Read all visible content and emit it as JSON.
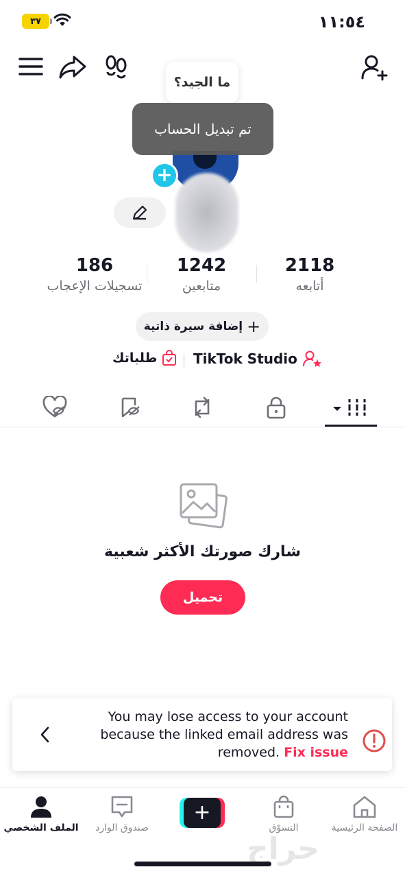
{
  "status_bar": {
    "time": "١١:٥٤",
    "battery": "٣٧"
  },
  "tooltip_question": "ما الجيد؟",
  "toast_message": "تم تبديل الحساب",
  "stats": {
    "likes": {
      "value": "186",
      "label": "تسجيلات الإعجاب"
    },
    "followers": {
      "value": "1242",
      "label": "متابعين"
    },
    "following": {
      "value": "2118",
      "label": "أتابعه"
    }
  },
  "bio_button": {
    "plus": "+",
    "label": "إضافة سيرة ذاتية"
  },
  "links": {
    "studio": "TikTok Studio",
    "orders": "طلباتك"
  },
  "empty_state": {
    "title": "شارك صورتك الأكثر شعبية",
    "button": "تحميل"
  },
  "banner": {
    "message": "You may lose access to your account because the linked email address was removed.",
    "fix_label": "Fix issue"
  },
  "bottom_nav": {
    "profile": "الملف الشخصي",
    "inbox": "صندوق الوارد",
    "create": "+",
    "shop": "التسوّق",
    "home": "الصفحة الرئيسية"
  },
  "colors": {
    "accent": "#fe2c55",
    "cyan": "#25f4ee",
    "text": "#161823",
    "muted": "#6e6f75"
  }
}
